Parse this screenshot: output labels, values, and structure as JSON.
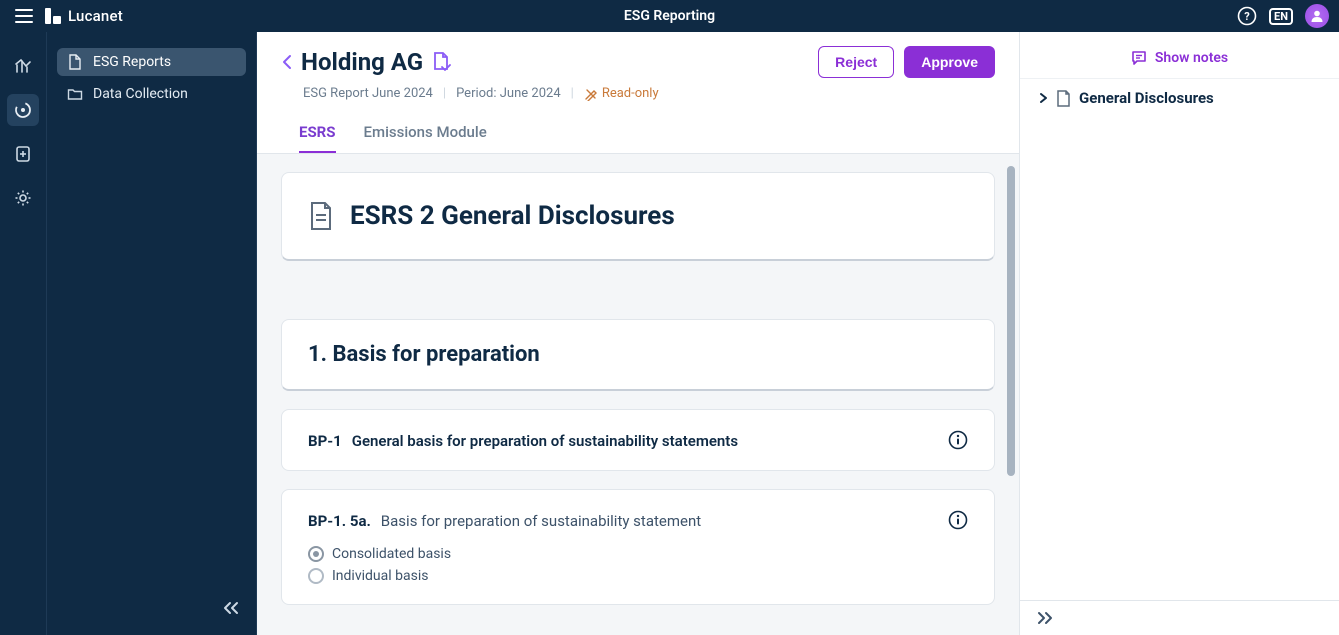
{
  "app": {
    "brand": "Lucanet",
    "header_title": "ESG Reporting",
    "language": "EN"
  },
  "sidebar": {
    "items": [
      {
        "label": "ESG Reports"
      },
      {
        "label": "Data Collection"
      }
    ]
  },
  "page": {
    "entity": "Holding AG",
    "report_name": "ESG Report June 2024",
    "period_label": "Period: June 2024",
    "readonly_label": "Read-only",
    "actions": {
      "reject": "Reject",
      "approve": "Approve"
    },
    "tabs": [
      {
        "label": "ESRS"
      },
      {
        "label": "Emissions Module"
      }
    ]
  },
  "content": {
    "main_heading": "ESRS 2 General Disclosures",
    "section_heading": "1. Basis for preparation",
    "bp1": {
      "code": "BP-1",
      "title": "General basis for preparation of sustainability statements"
    },
    "bp1_5a": {
      "code": "BP-1. 5a.",
      "title": "Basis for preparation of sustainability statement",
      "options": [
        {
          "label": "Consolidated basis",
          "selected": true
        },
        {
          "label": "Individual basis",
          "selected": false
        }
      ]
    }
  },
  "rightpanel": {
    "show_notes": "Show notes",
    "tree_root": "General Disclosures"
  }
}
